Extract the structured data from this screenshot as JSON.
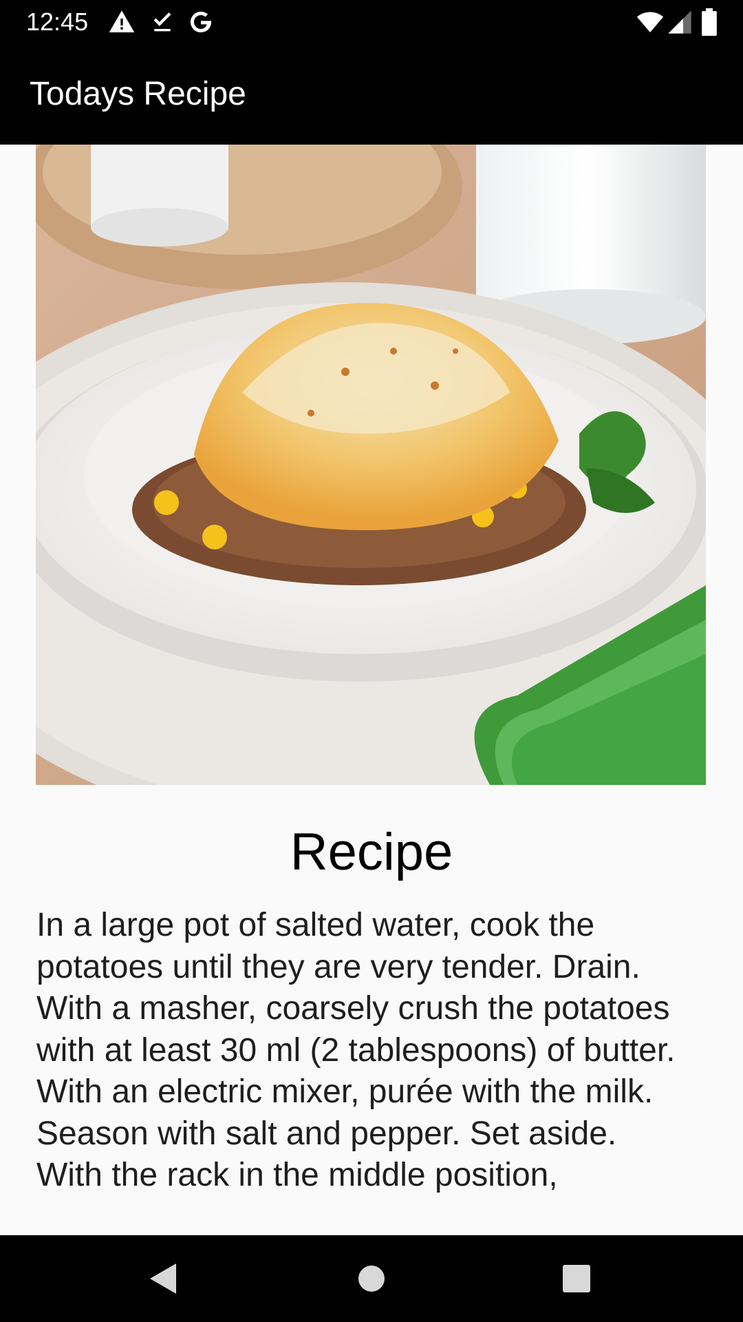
{
  "status_bar": {
    "time": "12:45",
    "notification_icons": [
      "warning-icon",
      "download-done-icon",
      "google-icon"
    ],
    "system_icons": [
      "wifi-icon",
      "cell-signal-icon",
      "battery-icon"
    ]
  },
  "app_bar": {
    "title": "Todays Recipe"
  },
  "recipe": {
    "image_alt": "Shepherd's pie on a white plate with corn, ground beef and parsley",
    "heading": "Recipe",
    "body": "In a large pot of salted water, cook the potatoes until they are very tender. Drain. With a masher, coarsely crush the potatoes with at least 30 ml (2 tablespoons) of butter. With an electric mixer, purée with the milk. Season with salt and pepper. Set aside.\nWith the rack in the middle position,"
  },
  "nav_bar": {
    "buttons": [
      "back-icon",
      "home-icon",
      "recents-icon"
    ]
  },
  "colors": {
    "bar_background": "#000000",
    "page_background": "#fafafa",
    "text": "#000000"
  }
}
